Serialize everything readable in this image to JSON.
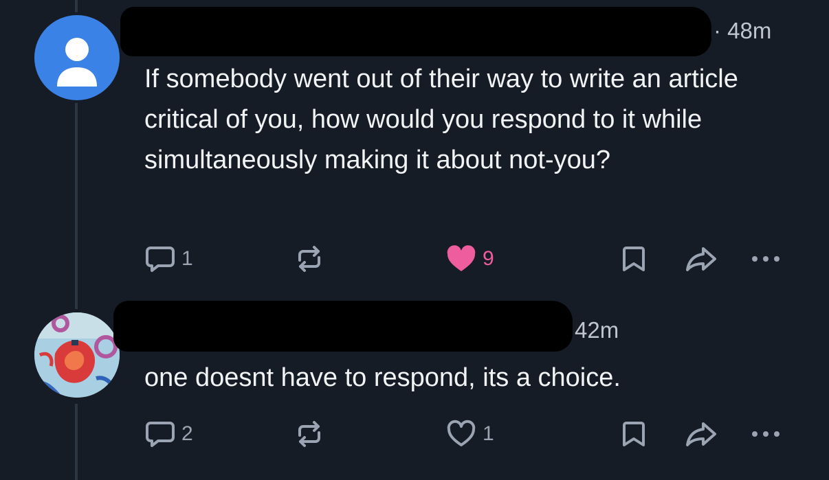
{
  "posts": [
    {
      "timestamp": "· 48m",
      "text": "If somebody went out of their way to write an article critical of you, how would you respond to it while simultaneously making it about not-you?",
      "avatar_icon": "default-user-avatar-icon",
      "replies": "1",
      "likes": "9",
      "liked": true
    },
    {
      "timestamp": "42m",
      "text": "one doesnt have to respond, its a choice.",
      "avatar_icon": "illustrated-avatar-image",
      "replies": "2",
      "likes": "1",
      "liked": false
    }
  ],
  "colors": {
    "background": "#161c26",
    "text": "#f1f3f5",
    "muted": "#9aa4b2",
    "like_accent": "#ee5d9e",
    "avatar_blue": "#3b82e6"
  }
}
